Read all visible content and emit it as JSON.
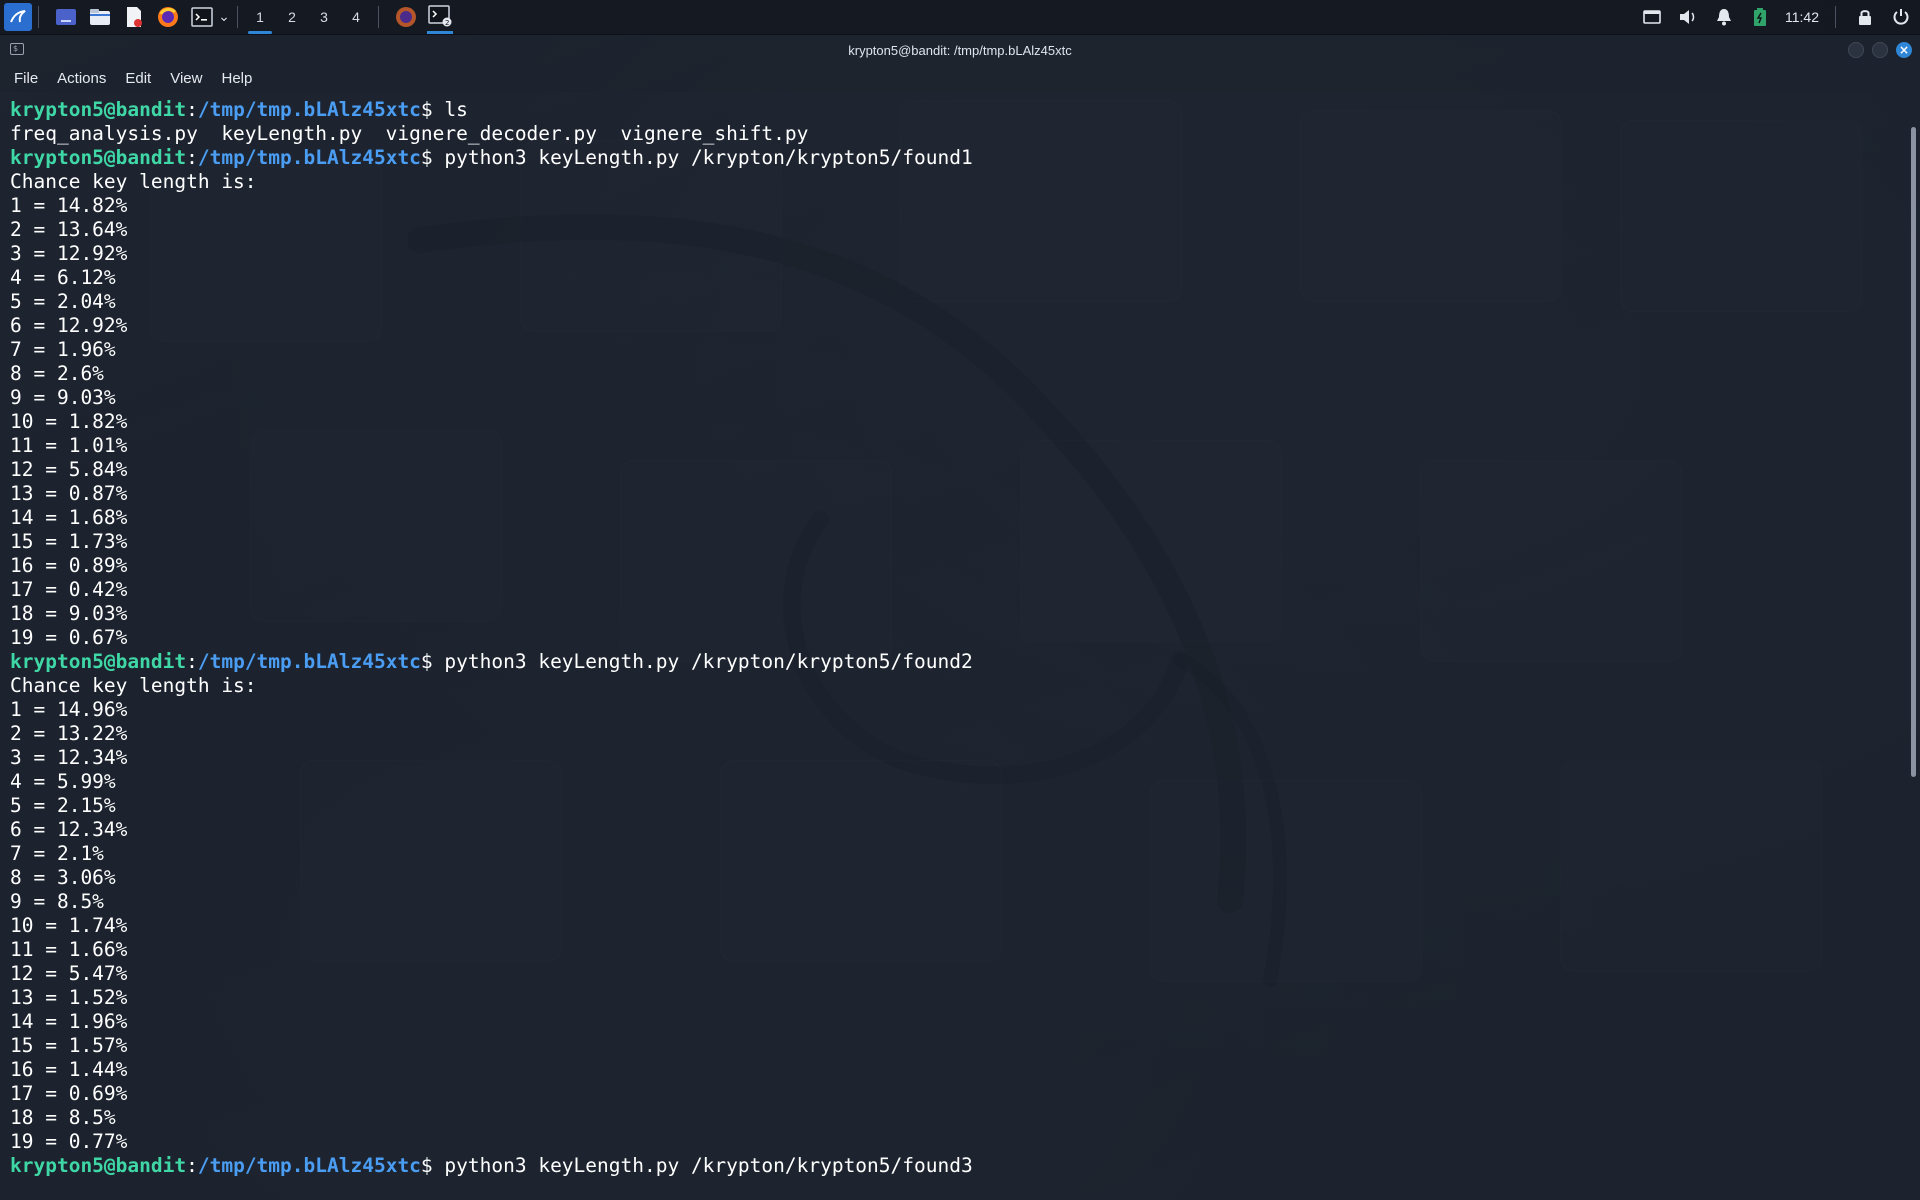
{
  "taskbar": {
    "launchers": [
      {
        "name": "kali-menu-icon",
        "glyph": "◆"
      },
      {
        "name": "desktop-icon",
        "glyph": "▭"
      },
      {
        "name": "file-manager-icon",
        "glyph": "▤"
      },
      {
        "name": "text-editor-icon",
        "glyph": "✎"
      },
      {
        "name": "firefox-icon",
        "glyph": "●"
      },
      {
        "name": "terminal-icon",
        "glyph": "▸_"
      },
      {
        "name": "chevron-down-icon",
        "glyph": "⌄"
      }
    ],
    "workspaces": [
      "1",
      "2",
      "3",
      "4"
    ],
    "active_workspace": "1",
    "clock": "11:42"
  },
  "window": {
    "title": "krypton5@bandit: /tmp/tmp.bLAlz45xtc",
    "menu": [
      "File",
      "Actions",
      "Edit",
      "View",
      "Help"
    ]
  },
  "terminal": {
    "prompt_user": "krypton5@bandit",
    "prompt_sep": ":",
    "prompt_path": "/tmp/tmp.bLAlz45xtc",
    "prompt_suffix": "$ ",
    "lines": [
      {
        "type": "prompt",
        "cmd": "ls"
      },
      {
        "type": "out",
        "text": "freq_analysis.py  keyLength.py  vignere_decoder.py  vignere_shift.py"
      },
      {
        "type": "prompt",
        "cmd": "python3 keyLength.py /krypton/krypton5/found1"
      },
      {
        "type": "out",
        "text": "Chance key length is:"
      },
      {
        "type": "out",
        "text": "1 = 14.82%"
      },
      {
        "type": "out",
        "text": "2 = 13.64%"
      },
      {
        "type": "out",
        "text": "3 = 12.92%"
      },
      {
        "type": "out",
        "text": "4 = 6.12%"
      },
      {
        "type": "out",
        "text": "5 = 2.04%"
      },
      {
        "type": "out",
        "text": "6 = 12.92%"
      },
      {
        "type": "out",
        "text": "7 = 1.96%"
      },
      {
        "type": "out",
        "text": "8 = 2.6%"
      },
      {
        "type": "out",
        "text": "9 = 9.03%"
      },
      {
        "type": "out",
        "text": "10 = 1.82%"
      },
      {
        "type": "out",
        "text": "11 = 1.01%"
      },
      {
        "type": "out",
        "text": "12 = 5.84%"
      },
      {
        "type": "out",
        "text": "13 = 0.87%"
      },
      {
        "type": "out",
        "text": "14 = 1.68%"
      },
      {
        "type": "out",
        "text": "15 = 1.73%"
      },
      {
        "type": "out",
        "text": "16 = 0.89%"
      },
      {
        "type": "out",
        "text": "17 = 0.42%"
      },
      {
        "type": "out",
        "text": "18 = 9.03%"
      },
      {
        "type": "out",
        "text": "19 = 0.67%"
      },
      {
        "type": "prompt",
        "cmd": "python3 keyLength.py /krypton/krypton5/found2"
      },
      {
        "type": "out",
        "text": "Chance key length is:"
      },
      {
        "type": "out",
        "text": "1 = 14.96%"
      },
      {
        "type": "out",
        "text": "2 = 13.22%"
      },
      {
        "type": "out",
        "text": "3 = 12.34%"
      },
      {
        "type": "out",
        "text": "4 = 5.99%"
      },
      {
        "type": "out",
        "text": "5 = 2.15%"
      },
      {
        "type": "out",
        "text": "6 = 12.34%"
      },
      {
        "type": "out",
        "text": "7 = 2.1%"
      },
      {
        "type": "out",
        "text": "8 = 3.06%"
      },
      {
        "type": "out",
        "text": "9 = 8.5%"
      },
      {
        "type": "out",
        "text": "10 = 1.74%"
      },
      {
        "type": "out",
        "text": "11 = 1.66%"
      },
      {
        "type": "out",
        "text": "12 = 5.47%"
      },
      {
        "type": "out",
        "text": "13 = 1.52%"
      },
      {
        "type": "out",
        "text": "14 = 1.96%"
      },
      {
        "type": "out",
        "text": "15 = 1.57%"
      },
      {
        "type": "out",
        "text": "16 = 1.44%"
      },
      {
        "type": "out",
        "text": "17 = 0.69%"
      },
      {
        "type": "out",
        "text": "18 = 8.5%"
      },
      {
        "type": "out",
        "text": "19 = 0.77%"
      },
      {
        "type": "prompt",
        "cmd": "python3 keyLength.py /krypton/krypton5/found3"
      }
    ]
  },
  "colors": {
    "prompt_user": "#3fd7a5",
    "prompt_path": "#4a9df2",
    "accent": "#2f86d6"
  }
}
